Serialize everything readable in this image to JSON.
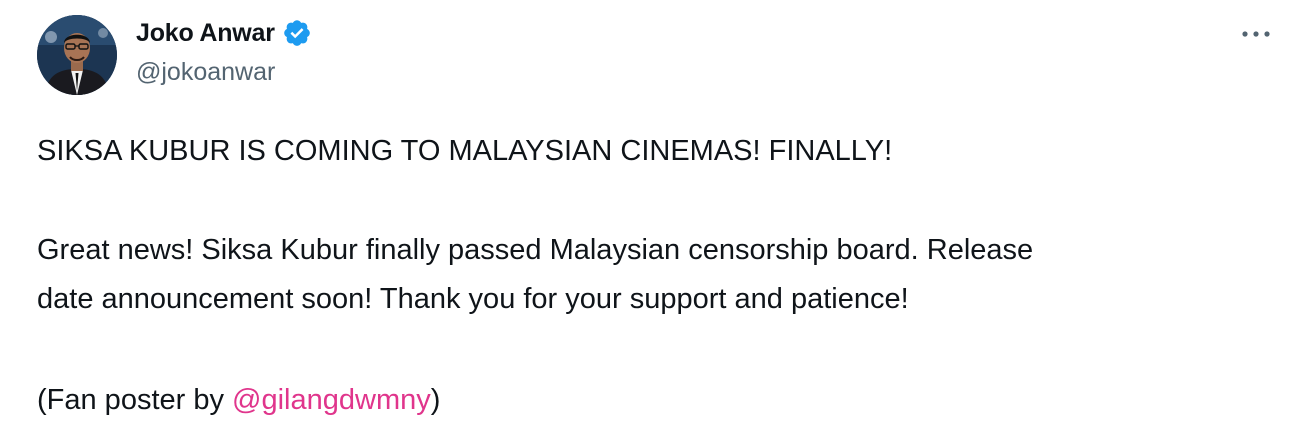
{
  "author": {
    "display_name": "Joko Anwar",
    "handle": "@jokoanwar",
    "verified_icon": "verified-badge-icon",
    "verified_color": "#1d9bf0"
  },
  "more_icon": "more-horizontal-icon",
  "tweet": {
    "headline": "SIKSA KUBUR IS COMING TO MALAYSIAN CINEMAS! FINALLY!",
    "paragraph_line1": "Great news! Siksa Kubur finally passed Malaysian censorship board. Release",
    "paragraph_line2": "date announcement soon! Thank you for your support and patience!",
    "credit_prefix": "(Fan poster by ",
    "credit_mention": "@gilangdwmny",
    "credit_suffix": ")"
  },
  "colors": {
    "text": "#0f1419",
    "secondary": "#536471",
    "mention": "#e0358c"
  }
}
